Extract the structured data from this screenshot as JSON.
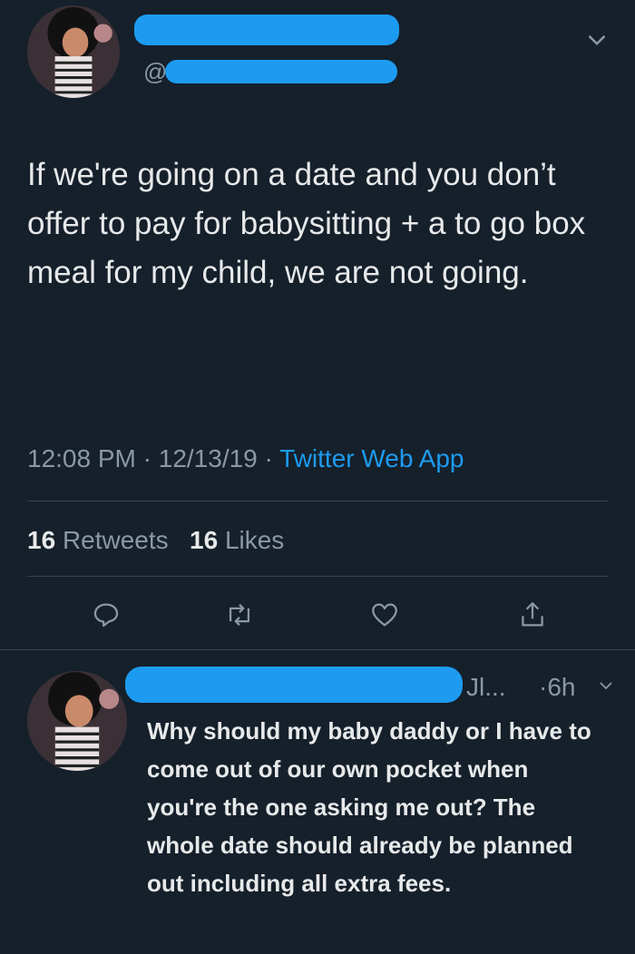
{
  "tweet": {
    "handle_prefix": "@",
    "text": "If we're going on a date and you don’t offer to pay for babysitting + a to go box meal for my child, we are not going.",
    "time": "12:08 PM",
    "date": "12/13/19",
    "source": "Twitter Web App",
    "retweets_count": "16",
    "retweets_label": "Retweets",
    "likes_count": "16",
    "likes_label": "Likes"
  },
  "reply": {
    "handle_tail": "Jl...",
    "age": "·6h",
    "text": "Why should my baby daddy or I have to come out of our own pocket when you're the one asking me out? The whole date should already be planned out including all extra fees."
  },
  "colors": {
    "background": "#15202b",
    "accent": "#1d9bf0",
    "muted": "#8b98a5",
    "text": "#e7e9ea"
  },
  "icons": [
    "chevron-down-icon",
    "reply-icon",
    "retweet-icon",
    "like-icon",
    "share-icon"
  ]
}
